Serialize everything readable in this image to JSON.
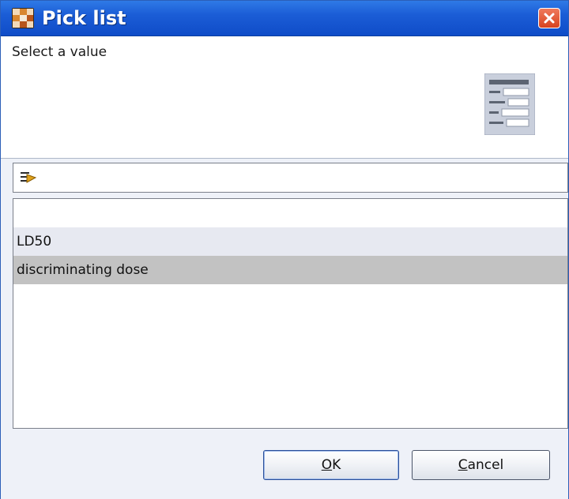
{
  "window": {
    "title": "Pick list",
    "close_icon": "close-icon",
    "app_icon": "app-icon"
  },
  "header": {
    "message": "Select a value",
    "icon": "form-document-icon"
  },
  "filter": {
    "icon": "filter-icon",
    "value": "",
    "placeholder": ""
  },
  "list": {
    "items": [
      {
        "label": "",
        "state": "normal"
      },
      {
        "label": "LD50",
        "state": "alternate"
      },
      {
        "label": "discriminating dose",
        "state": "selected"
      }
    ]
  },
  "buttons": {
    "ok": {
      "mnemonic": "O",
      "rest": "K"
    },
    "cancel": {
      "mnemonic": "C",
      "rest": "ancel"
    }
  },
  "colors": {
    "titlebar": "#1b5dd6",
    "close": "#d8431f",
    "row_alternate": "#e7e9f1",
    "row_selected": "#c2c2c2"
  }
}
